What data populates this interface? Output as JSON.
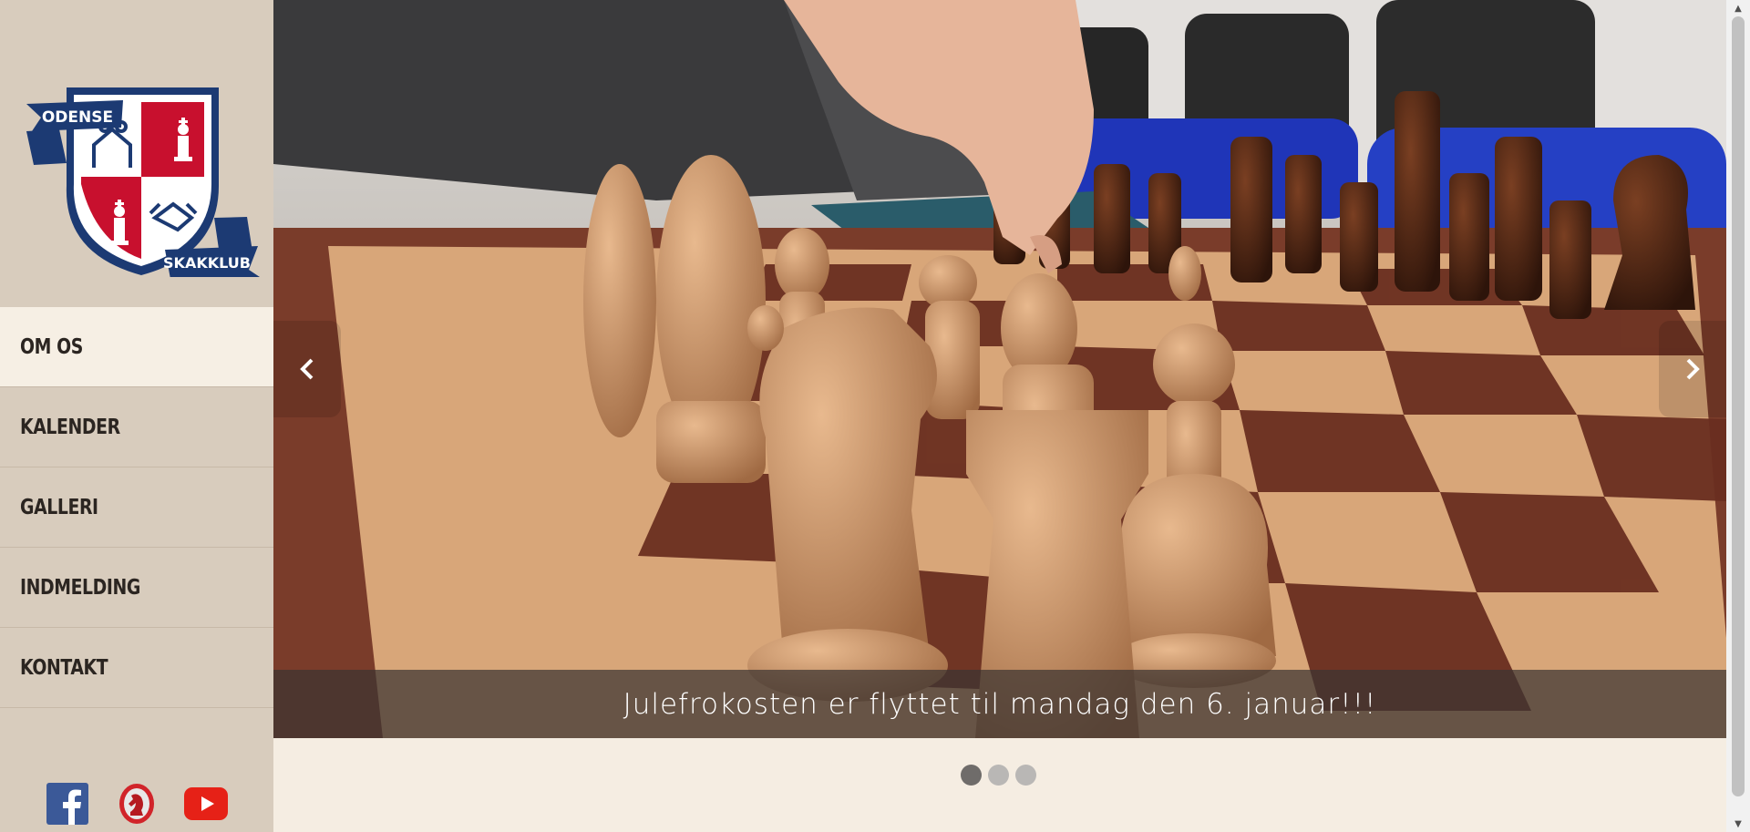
{
  "logo": {
    "text_top": "ODENSE",
    "text_bottom": "SKAKKLUB",
    "colors": {
      "navy": "#1c3a73",
      "red": "#c8102e",
      "white": "#ffffff"
    }
  },
  "nav": {
    "items": [
      {
        "label": "OM OS",
        "active": true
      },
      {
        "label": "KALENDER",
        "active": false
      },
      {
        "label": "GALLERI",
        "active": false
      },
      {
        "label": "INDMELDING",
        "active": false
      },
      {
        "label": "KONTAKT",
        "active": false
      }
    ]
  },
  "socials": [
    {
      "icon": "facebook-icon",
      "color": "#3b5998"
    },
    {
      "icon": "chess-knight-icon",
      "color": "#d1242a"
    },
    {
      "icon": "youtube-icon",
      "color": "#e62117"
    }
  ],
  "slider": {
    "caption": "Julefrokosten er flyttet til mandag den 6. januar!!!",
    "slide_count": 3,
    "active_slide": 1
  },
  "scrollbar": {
    "up": "▲",
    "down": "▼"
  }
}
